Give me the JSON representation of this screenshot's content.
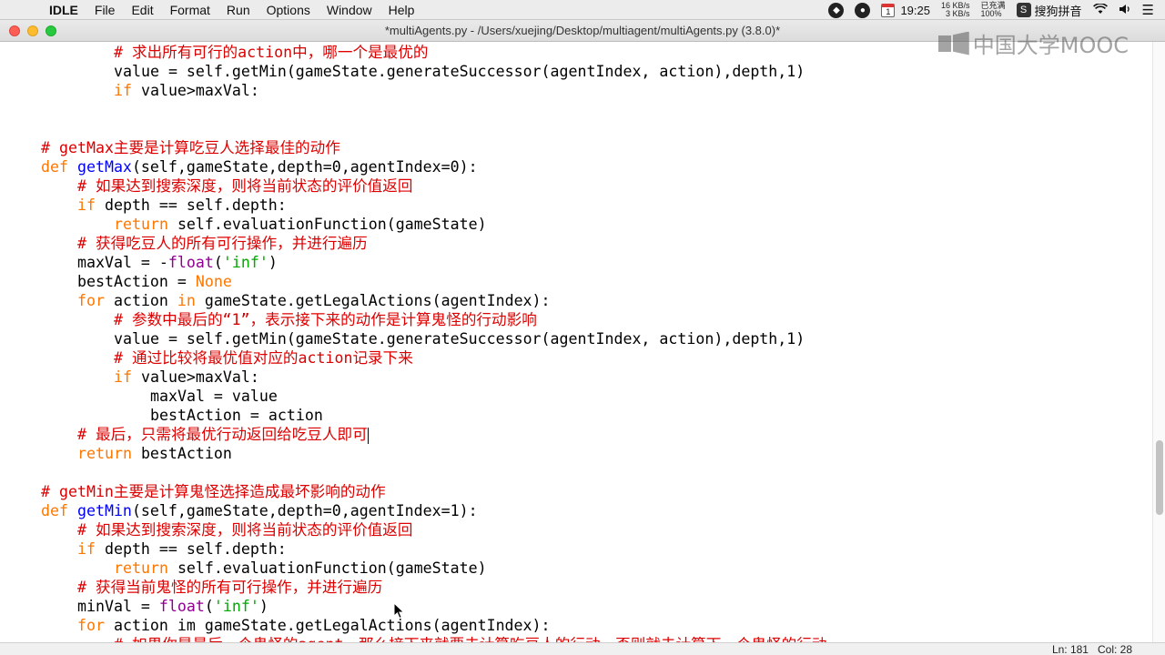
{
  "menubar": {
    "apple_glyph": "",
    "items": [
      "IDLE",
      "File",
      "Edit",
      "Format",
      "Run",
      "Options",
      "Window",
      "Help"
    ],
    "status": {
      "calendar_day": "1",
      "time": "19:25",
      "net_up": "16 KB/s",
      "net_down": "3 KB/s",
      "battery_label": "已充满",
      "battery_percent": "100%",
      "ime_badge": "S",
      "ime_name": "搜狗拼音"
    }
  },
  "window": {
    "title": "*multiAgents.py - /Users/xuejing/Desktop/multiagent/multiAgents.py (3.8.0)*"
  },
  "watermark": {
    "text": "中国大学MOOC"
  },
  "colors": {
    "comment": "#dd0000",
    "keyword": "#ff7700",
    "builtin": "#900090",
    "def_name": "#0000ff",
    "string": "#00aa00"
  },
  "code": [
    {
      "indent": 2,
      "tokens": [
        [
          "comment",
          "# 求出所有可行的action中，哪一个是最优的"
        ]
      ]
    },
    {
      "indent": 2,
      "tokens": [
        [
          "plain",
          "value = self.getMin(gameState.generateSuccessor(agentIndex, action),depth,1)"
        ]
      ]
    },
    {
      "indent": 2,
      "tokens": [
        [
          "keyword",
          "if"
        ],
        [
          "plain",
          " value>maxVal:"
        ]
      ]
    },
    {
      "indent": 0,
      "tokens": []
    },
    {
      "indent": 0,
      "tokens": []
    },
    {
      "indent": 0,
      "tokens": [
        [
          "comment",
          "# getMax主要是计算吃豆人选择最佳的动作"
        ]
      ]
    },
    {
      "indent": 0,
      "tokens": [
        [
          "keyword",
          "def"
        ],
        [
          "plain",
          " "
        ],
        [
          "def",
          "getMax"
        ],
        [
          "plain",
          "(self,gameState,depth=0,agentIndex=0):"
        ]
      ]
    },
    {
      "indent": 1,
      "tokens": [
        [
          "comment",
          "# 如果达到搜索深度，则将当前状态的评价值返回"
        ]
      ]
    },
    {
      "indent": 1,
      "tokens": [
        [
          "keyword",
          "if"
        ],
        [
          "plain",
          " depth == self.depth:"
        ]
      ]
    },
    {
      "indent": 2,
      "tokens": [
        [
          "keyword",
          "return"
        ],
        [
          "plain",
          " self.evaluationFunction(gameState)"
        ]
      ]
    },
    {
      "indent": 1,
      "tokens": [
        [
          "comment",
          "# 获得吃豆人的所有可行操作，并进行遍历"
        ]
      ]
    },
    {
      "indent": 1,
      "tokens": [
        [
          "plain",
          "maxVal = -"
        ],
        [
          "builtin",
          "float"
        ],
        [
          "plain",
          "("
        ],
        [
          "string",
          "'inf'"
        ],
        [
          "plain",
          ")"
        ]
      ]
    },
    {
      "indent": 1,
      "tokens": [
        [
          "plain",
          "bestAction = "
        ],
        [
          "keyword",
          "None"
        ]
      ]
    },
    {
      "indent": 1,
      "tokens": [
        [
          "keyword",
          "for"
        ],
        [
          "plain",
          " action "
        ],
        [
          "keyword",
          "in"
        ],
        [
          "plain",
          " gameState.getLegalActions(agentIndex):"
        ]
      ]
    },
    {
      "indent": 2,
      "tokens": [
        [
          "comment",
          "# 参数中最后的“1”，表示接下来的动作是计算鬼怪的行动影响"
        ]
      ]
    },
    {
      "indent": 2,
      "tokens": [
        [
          "plain",
          "value = self.getMin(gameState.generateSuccessor(agentIndex, action),depth,1)"
        ]
      ]
    },
    {
      "indent": 2,
      "tokens": [
        [
          "comment",
          "# 通过比较将最优值对应的action记录下来"
        ]
      ]
    },
    {
      "indent": 2,
      "tokens": [
        [
          "keyword",
          "if"
        ],
        [
          "plain",
          " value>maxVal:"
        ]
      ]
    },
    {
      "indent": 3,
      "tokens": [
        [
          "plain",
          "maxVal = value"
        ]
      ]
    },
    {
      "indent": 3,
      "tokens": [
        [
          "plain",
          "bestAction = action"
        ]
      ]
    },
    {
      "indent": 1,
      "tokens": [
        [
          "comment",
          "# 最后，只需将最优行动返回给吃豆人即可"
        ]
      ],
      "caret": true
    },
    {
      "indent": 1,
      "tokens": [
        [
          "keyword",
          "return"
        ],
        [
          "plain",
          " bestAction"
        ]
      ]
    },
    {
      "indent": 0,
      "tokens": []
    },
    {
      "indent": 0,
      "tokens": [
        [
          "comment",
          "# getMin主要是计算鬼怪选择造成最坏影响的动作"
        ]
      ]
    },
    {
      "indent": 0,
      "tokens": [
        [
          "keyword",
          "def"
        ],
        [
          "plain",
          " "
        ],
        [
          "def",
          "getMin"
        ],
        [
          "plain",
          "(self,gameState,depth=0,agentIndex=1):"
        ]
      ]
    },
    {
      "indent": 1,
      "tokens": [
        [
          "comment",
          "# 如果达到搜索深度，则将当前状态的评价值返回"
        ]
      ]
    },
    {
      "indent": 1,
      "tokens": [
        [
          "keyword",
          "if"
        ],
        [
          "plain",
          " depth == self.depth:"
        ]
      ]
    },
    {
      "indent": 2,
      "tokens": [
        [
          "keyword",
          "return"
        ],
        [
          "plain",
          " self.evaluationFunction(gameState)"
        ]
      ]
    },
    {
      "indent": 1,
      "tokens": [
        [
          "comment",
          "# 获得当前鬼怪的所有可行操作，并进行遍历"
        ]
      ]
    },
    {
      "indent": 1,
      "tokens": [
        [
          "plain",
          "minVal = "
        ],
        [
          "builtin",
          "float"
        ],
        [
          "plain",
          "("
        ],
        [
          "string",
          "'inf'"
        ],
        [
          "plain",
          ")"
        ]
      ]
    },
    {
      "indent": 1,
      "tokens": [
        [
          "keyword",
          "for"
        ],
        [
          "plain",
          " action im gameState.getLegalActions(agentIndex):"
        ]
      ]
    },
    {
      "indent": 2,
      "tokens": [
        [
          "comment",
          "# 如果你是最后一个鬼怪的agent，那么接下来就要去计算吃豆人的行动，否则就去计算下一个鬼怪的行动"
        ]
      ]
    }
  ],
  "statusbar": {
    "position": "Ln: 181   Col: 28"
  }
}
